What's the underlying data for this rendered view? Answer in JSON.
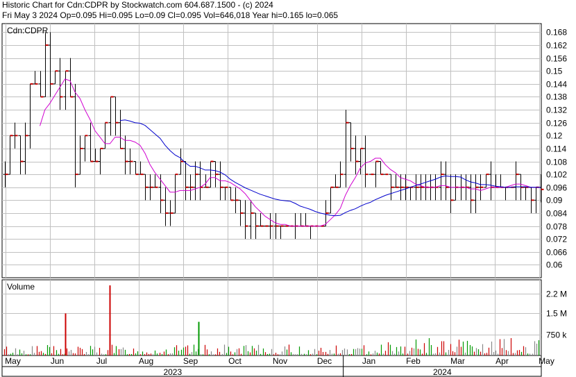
{
  "header": {
    "line1": "Historic Chart for Cdn:CDPR by Stockwatch.com 604.687.1500 - (c) 2024",
    "line2": "Fri May  3 2024  Op=0.095  Hi=0.095  Lo=0.09  Cl=0.095  Vol=646,018  Year hi=0.165  lo=0.065"
  },
  "chart_data": [
    {
      "type": "ohlc",
      "title": "Cdn:CDPR",
      "y_ticks": [
        "0.168",
        "0.162",
        "0.156",
        "0.15",
        "0.144",
        "0.138",
        "0.132",
        "0.126",
        "0.12",
        "0.114",
        "0.108",
        "0.102",
        "0.096",
        "0.09",
        "0.084",
        "0.078",
        "0.072",
        "0.066",
        "0.06"
      ],
      "ylim": [
        0.054,
        0.172
      ],
      "x_months": [
        "May",
        "Jun",
        "Jul",
        "Aug",
        "Sep",
        "Oct",
        "Nov",
        "Dec",
        "Jan",
        "Feb",
        "Mar",
        "Apr",
        "May"
      ],
      "x_years": [
        "2023",
        "2024"
      ],
      "grid": true,
      "close_weekly": [
        0.102,
        0.12,
        0.12,
        0.108,
        0.12,
        0.144,
        0.144,
        0.138,
        0.162,
        0.144,
        0.15,
        0.138,
        0.15,
        0.138,
        0.102,
        0.114,
        0.12,
        0.108,
        0.108,
        0.114,
        0.126,
        0.138,
        0.126,
        0.114,
        0.108,
        0.108,
        0.102,
        0.102,
        0.096,
        0.096,
        0.096,
        0.09,
        0.084,
        0.084,
        0.102,
        0.108,
        0.096,
        0.096,
        0.102,
        0.096,
        0.096,
        0.108,
        0.102,
        0.096,
        0.096,
        0.09,
        0.09,
        0.084,
        0.078,
        0.084,
        0.078,
        0.078,
        0.078,
        0.078,
        0.078,
        0.078,
        0.078,
        0.078,
        0.078,
        0.078,
        0.078,
        0.078,
        0.078,
        0.078,
        0.084,
        0.096,
        0.096,
        0.102,
        0.126,
        0.114,
        0.108,
        0.114,
        0.102,
        0.102,
        0.108,
        0.102,
        0.102,
        0.096,
        0.096,
        0.096,
        0.096,
        0.096,
        0.096,
        0.096,
        0.096,
        0.096,
        0.096,
        0.102,
        0.096,
        0.09,
        0.096,
        0.096,
        0.096,
        0.09,
        0.096,
        0.096,
        0.102,
        0.096,
        0.096,
        0.096,
        0.096,
        0.096,
        0.102,
        0.096,
        0.096,
        0.09,
        0.096,
        0.095
      ],
      "moving_averages": [
        {
          "color": "#d000d0",
          "label": "short"
        },
        {
          "color": "#0000cc",
          "label": "long"
        }
      ],
      "colors": {
        "up": "#000000",
        "down": "#cc0000",
        "grid": "#c0c0c0"
      }
    },
    {
      "type": "bar",
      "title": "Volume",
      "y_ticks": [
        "2.2 M",
        "1.5 M",
        "750 k"
      ],
      "ylim": [
        0,
        2.6
      ],
      "unit": "M",
      "spikes": [
        {
          "month_index": 1,
          "value": 1.5,
          "color": "#cc0000"
        },
        {
          "month_index": 2,
          "value": 2.5,
          "color": "#cc0000"
        },
        {
          "month_index": 4,
          "value": 1.2,
          "color": "#009900"
        }
      ],
      "colors": {
        "up": "#009900",
        "down": "#cc0000",
        "flat": "#888888"
      }
    }
  ]
}
